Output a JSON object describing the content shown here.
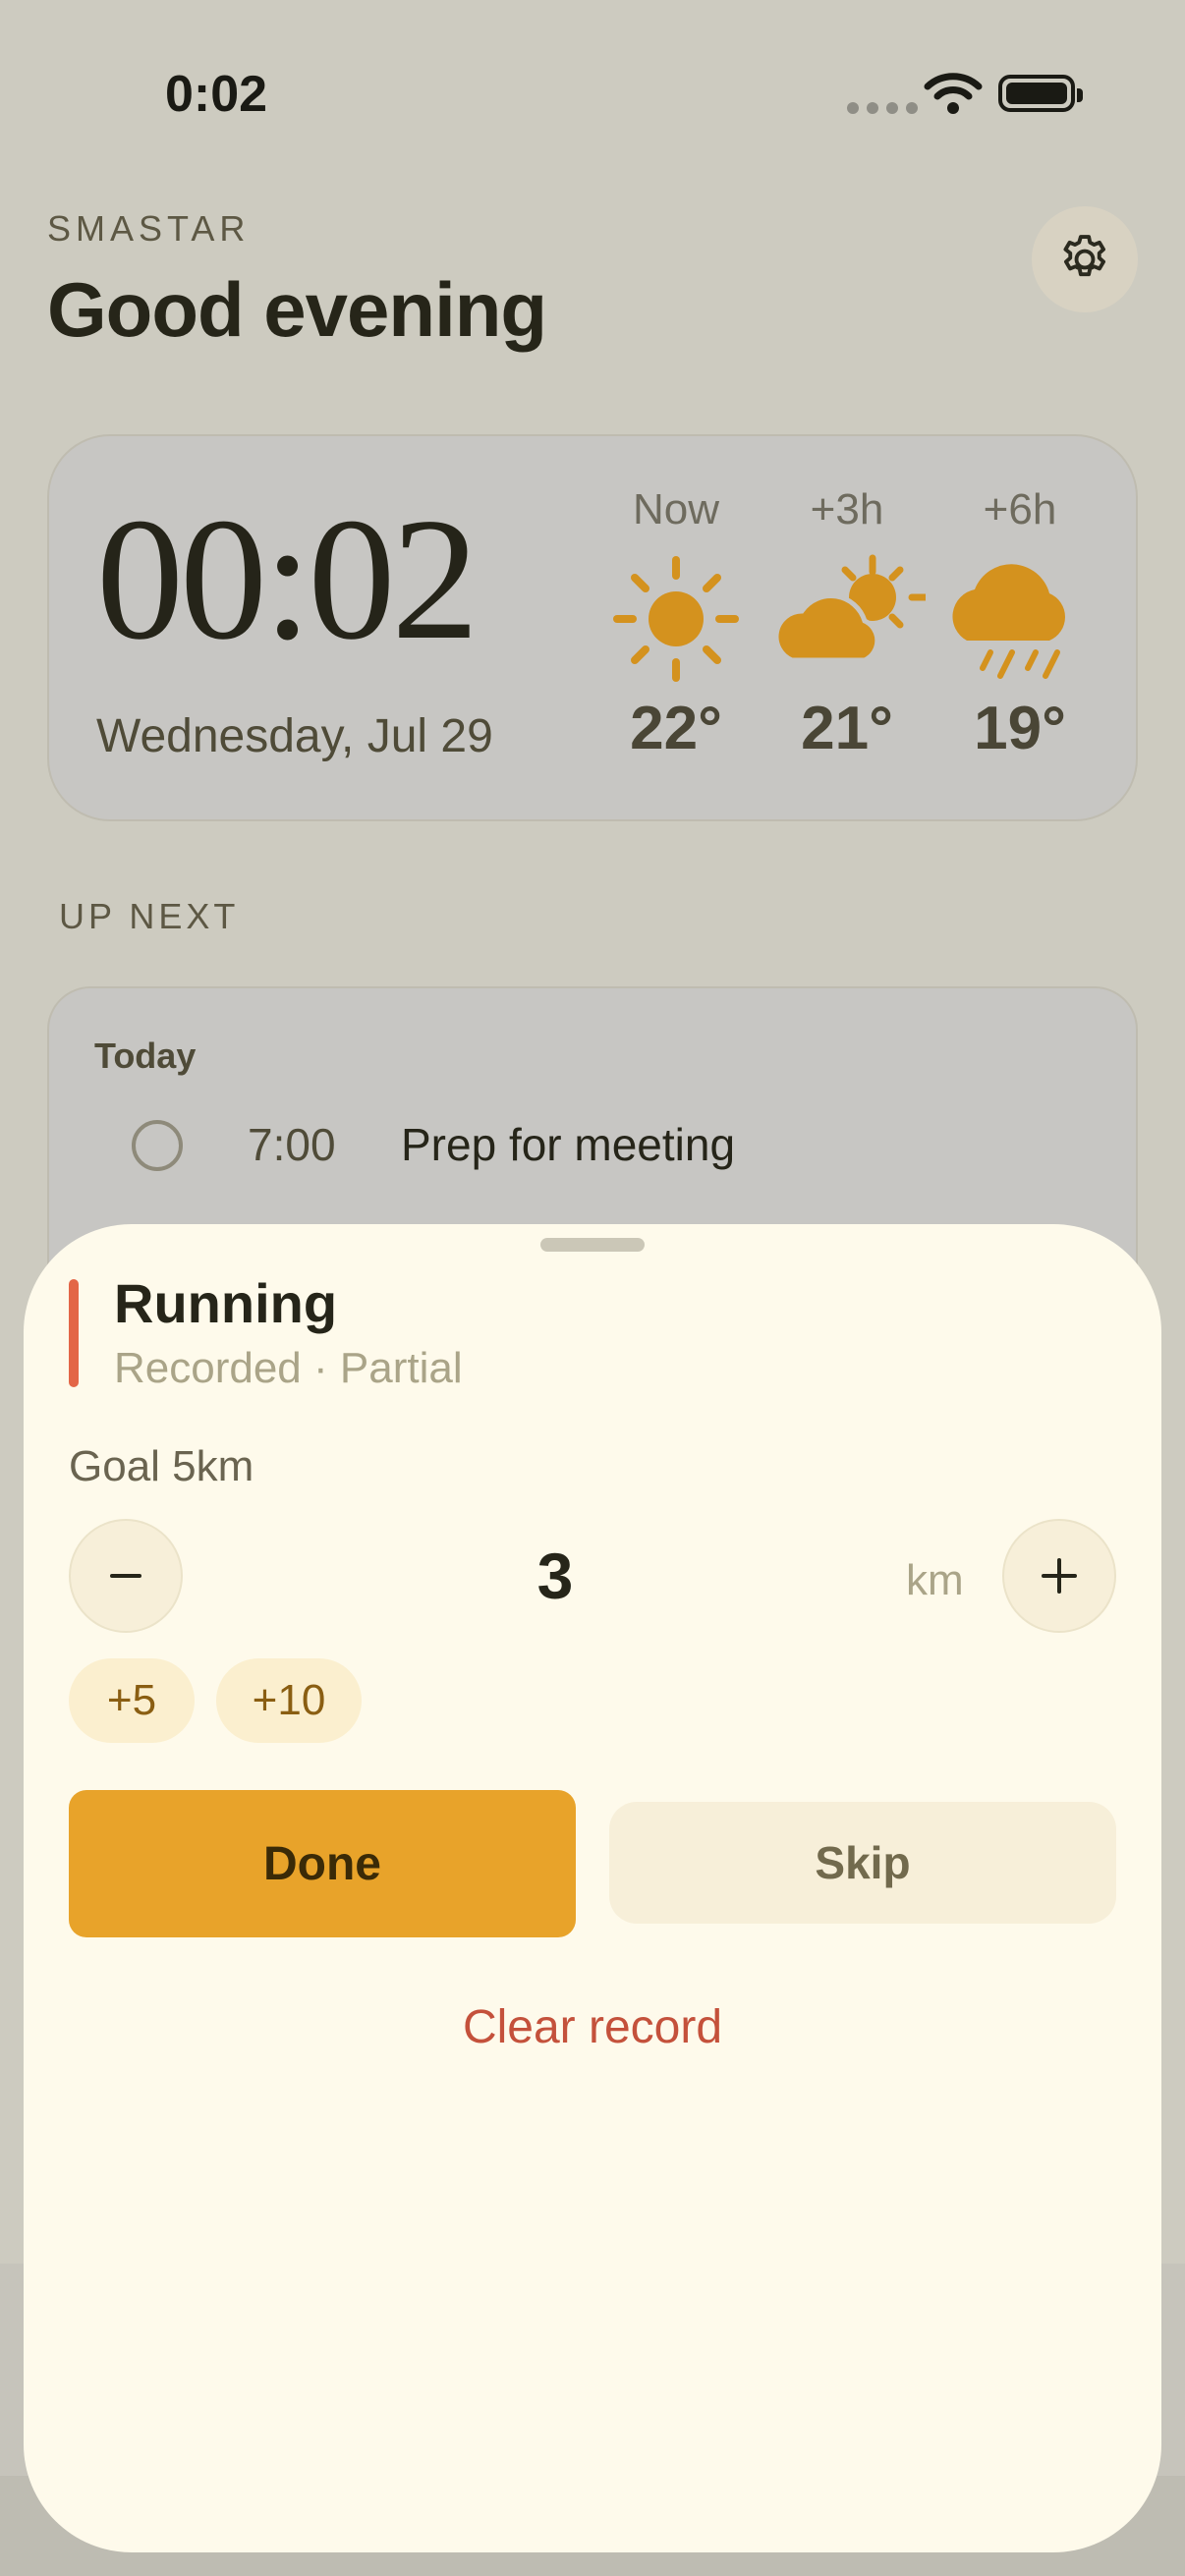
{
  "status_bar": {
    "time": "0:02"
  },
  "header": {
    "brand": "SMASTAR",
    "greeting": "Good evening"
  },
  "clock_card": {
    "time": "00:02",
    "date": "Wednesday, Jul 29",
    "weather": [
      {
        "label": "Now",
        "icon": "sun-icon",
        "temp": "22°"
      },
      {
        "label": "+3h",
        "icon": "partly-cloudy-icon",
        "temp": "21°"
      },
      {
        "label": "+6h",
        "icon": "rain-cloud-icon",
        "temp": "19°"
      }
    ]
  },
  "up_next": {
    "title": "UP NEXT",
    "day": "Today",
    "tasks": [
      {
        "time": "7:00",
        "title": "Prep for meeting"
      }
    ]
  },
  "sheet": {
    "title": "Running",
    "subtitle": "Recorded · Partial",
    "goal": "Goal 5km",
    "value": "3",
    "unit": "km",
    "quick_add": [
      "+5",
      "+10"
    ],
    "done_label": "Done",
    "skip_label": "Skip",
    "clear_label": "Clear record",
    "accent_color": "#e36647"
  },
  "colors": {
    "primary": "#e8a32a",
    "danger": "#c4513b",
    "weather_icon": "#d4921e"
  }
}
